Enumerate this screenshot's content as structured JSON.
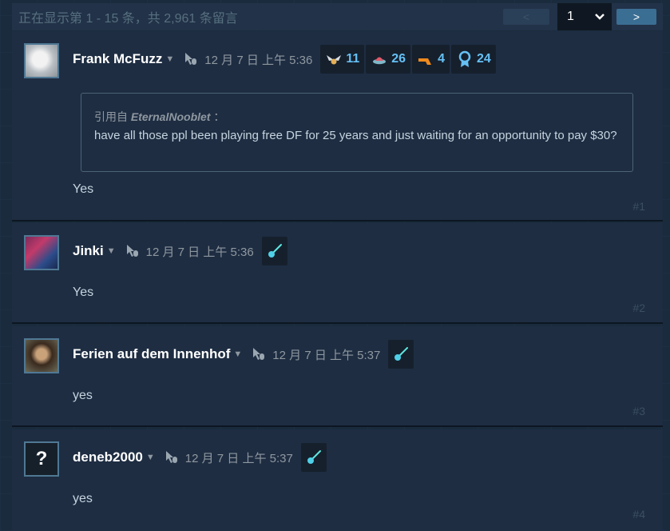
{
  "pagination": {
    "summary": "正在显示第 1 - 15 条，共 2,961 条留言",
    "prev_label": "<",
    "page_value": "1",
    "next_label": ">"
  },
  "comments": [
    {
      "author": "Frank McFuzz",
      "date": "12 月 7 日 上午 5:36",
      "awards": [
        {
          "icon": "wings-award-icon",
          "count": "11"
        },
        {
          "icon": "ufo-award-icon",
          "count": "26"
        },
        {
          "icon": "boomerang-award-icon",
          "count": "4"
        },
        {
          "icon": "medal-award-icon",
          "count": "24"
        }
      ],
      "quote": {
        "prefix": "引用自",
        "author": "EternalNooblet",
        "suffix": "：",
        "text": "have all those ppl been playing free DF for 25 years and just waiting for an opportunity to pay $30?"
      },
      "text": "Yes",
      "number": "#1"
    },
    {
      "author": "Jinki",
      "date": "12 月 7 日 上午 5:36",
      "award_icon": "comet-award-icon",
      "text": "Yes",
      "number": "#2"
    },
    {
      "author": "Ferien auf dem Innenhof",
      "date": "12 月 7 日 上午 5:37",
      "award_icon": "comet-award-icon",
      "text": "yes",
      "number": "#3"
    },
    {
      "author": "deneb2000",
      "date": "12 月 7 日 上午 5:37",
      "award_icon": "comet-award-icon",
      "text": "yes",
      "number": "#4"
    }
  ]
}
